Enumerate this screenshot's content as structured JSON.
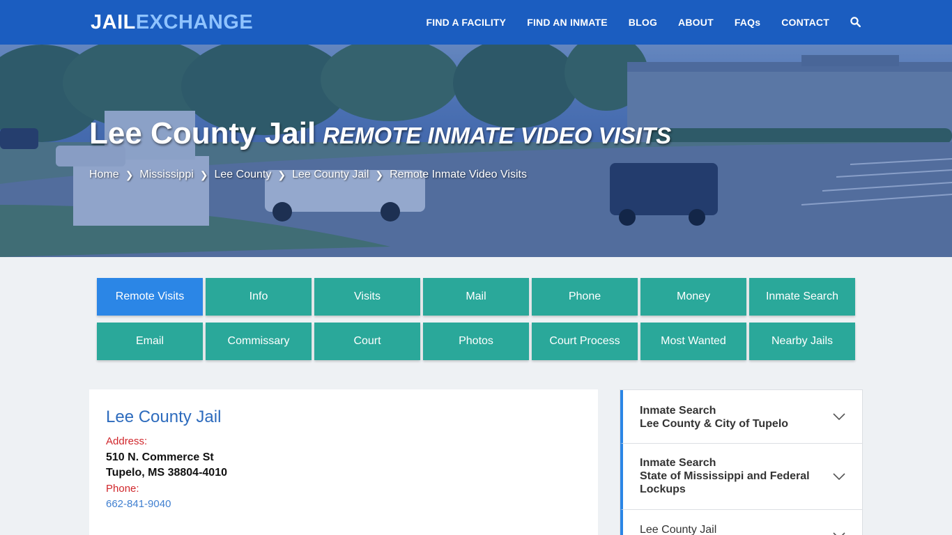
{
  "brand": {
    "part1": "JAIL",
    "part2": "EXCHANGE"
  },
  "nav": {
    "items": [
      "FIND A FACILITY",
      "FIND AN INMATE",
      "BLOG",
      "ABOUT",
      "FAQs",
      "CONTACT"
    ],
    "search_icon": "search-icon"
  },
  "hero": {
    "title": "Lee County Jail",
    "subtitle": "REMOTE INMATE VIDEO VISITS",
    "breadcrumbs": [
      "Home",
      "Mississippi",
      "Lee County",
      "Lee County Jail",
      "Remote Inmate Video Visits"
    ]
  },
  "tabs": {
    "row1": [
      "Remote Visits",
      "Info",
      "Visits",
      "Mail",
      "Phone",
      "Money",
      "Inmate Search"
    ],
    "row2": [
      "Email",
      "Commissary",
      "Court",
      "Photos",
      "Court Process",
      "Most Wanted",
      "Nearby Jails"
    ],
    "active": "Remote Visits"
  },
  "card": {
    "title": "Lee County Jail",
    "address_label": "Address:",
    "address_line1": "510 N. Commerce St",
    "address_line2": "Tupelo, MS 38804-4010",
    "phone_label": "Phone:",
    "phone": "662-841-9040"
  },
  "sidebar": {
    "items": [
      {
        "line1": "Inmate Search",
        "line2": "Lee County & City of Tupelo"
      },
      {
        "line1": "Inmate Search",
        "line2": "State of Mississippi and Federal",
        "line3": "Lockups"
      },
      {
        "line1": "Lee County Jail"
      }
    ]
  },
  "colors": {
    "navbar": "#1b5dc0",
    "tab": "#2aa89a",
    "tab_active": "#2b86e6",
    "label_red": "#d0262b",
    "link_blue": "#3f7fd0"
  }
}
